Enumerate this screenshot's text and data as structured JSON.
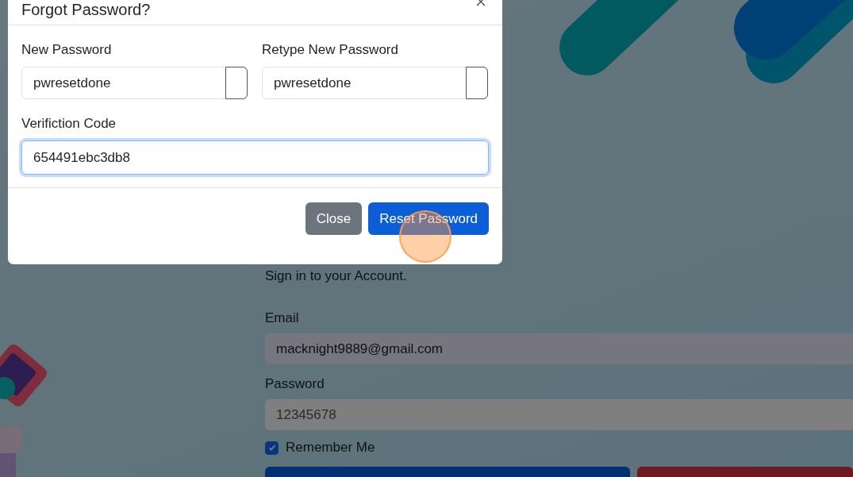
{
  "login": {
    "subtitle": "Sign in to your Account.",
    "fields": [
      {
        "label": "Email",
        "value": "macknight9889@gmail.com",
        "kind": "email"
      },
      {
        "label": "Password",
        "value": "12345678",
        "kind": "password"
      }
    ],
    "remember": {
      "label": "Remember Me",
      "checked": true
    },
    "buttons": [
      {
        "kind": "primary"
      },
      {
        "kind": "danger"
      }
    ]
  },
  "modal": {
    "title": "Forgot Password?",
    "fields": [
      {
        "label": "New Password",
        "value": "pwresetdone",
        "kind": "password",
        "focused": false
      },
      {
        "label": "Retype New Password",
        "value": "pwresetdone",
        "kind": "password",
        "focused": false
      },
      {
        "label": "Verifiction Code",
        "value": "654491ebc3db8",
        "kind": "text",
        "focused": true
      }
    ],
    "buttons": [
      {
        "label": "Close",
        "kind": "secondary"
      },
      {
        "label": "Reset Password",
        "kind": "primary"
      }
    ]
  }
}
